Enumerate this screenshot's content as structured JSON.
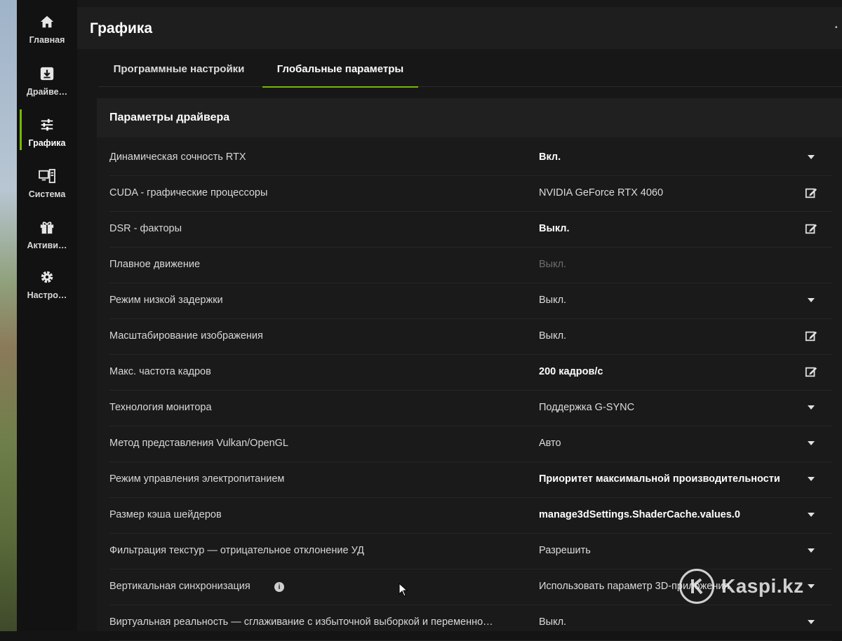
{
  "sidebar": {
    "items": [
      {
        "label": "Главная",
        "icon": "home-icon"
      },
      {
        "label": "Драйве…",
        "icon": "download-icon"
      },
      {
        "label": "Графика",
        "icon": "sliders-icon",
        "active": true
      },
      {
        "label": "Система",
        "icon": "system-icon"
      },
      {
        "label": "Активи…",
        "icon": "gift-icon"
      },
      {
        "label": "Настро…",
        "icon": "gear-icon"
      }
    ]
  },
  "header": {
    "title": "Графика"
  },
  "tabs": [
    {
      "label": "Программные настройки"
    },
    {
      "label": "Глобальные параметры",
      "active": true
    }
  ],
  "panel": {
    "title": "Параметры драйвера",
    "rows": [
      {
        "name": "Динамическая сочность RTX",
        "value": "Вкл.",
        "style": "bold",
        "control": "dropdown"
      },
      {
        "name": "CUDA - графические процессоры",
        "value": "NVIDIA GeForce RTX 4060",
        "style": "normal",
        "control": "edit"
      },
      {
        "name": "DSR - факторы",
        "value": "Выкл.",
        "style": "bold",
        "control": "edit"
      },
      {
        "name": "Плавное движение",
        "value": "Выкл.",
        "style": "dim",
        "control": "none"
      },
      {
        "name": "Режим низкой задержки",
        "value": "Выкл.",
        "style": "normal",
        "control": "dropdown"
      },
      {
        "name": "Масштабирование изображения",
        "value": "Выкл.",
        "style": "normal",
        "control": "edit"
      },
      {
        "name": "Макс. частота кадров",
        "value": "200 кадров/с",
        "style": "bold",
        "control": "edit"
      },
      {
        "name": "Технология монитора",
        "value": "Поддержка G-SYNC",
        "style": "normal",
        "control": "dropdown"
      },
      {
        "name": "Метод представления Vulkan/OpenGL",
        "value": "Авто",
        "style": "normal",
        "control": "dropdown"
      },
      {
        "name": "Режим управления электропитанием",
        "value": "Приоритет максимальной производительности",
        "style": "bold",
        "control": "dropdown"
      },
      {
        "name": "Размер кэша шейдеров",
        "value": "manage3dSettings.ShaderCache.values.0",
        "style": "bold",
        "control": "dropdown"
      },
      {
        "name": "Фильтрация текстур — отрицательное отклонение УД",
        "value": "Разрешить",
        "style": "normal",
        "control": "dropdown"
      },
      {
        "name": "Вертикальная синхронизация",
        "value": "Использовать параметр 3D-приложения",
        "style": "normal",
        "control": "dropdown",
        "info": true
      },
      {
        "name": "Виртуальная реальность — сглаживание с избыточной выборкой и переменно…",
        "value": "Выкл.",
        "style": "normal",
        "control": "dropdown"
      }
    ]
  },
  "watermark": {
    "text": "Kaspi.kz"
  },
  "colors": {
    "accent": "#76b900",
    "background": "#171717",
    "panel": "#1a1a1a"
  }
}
